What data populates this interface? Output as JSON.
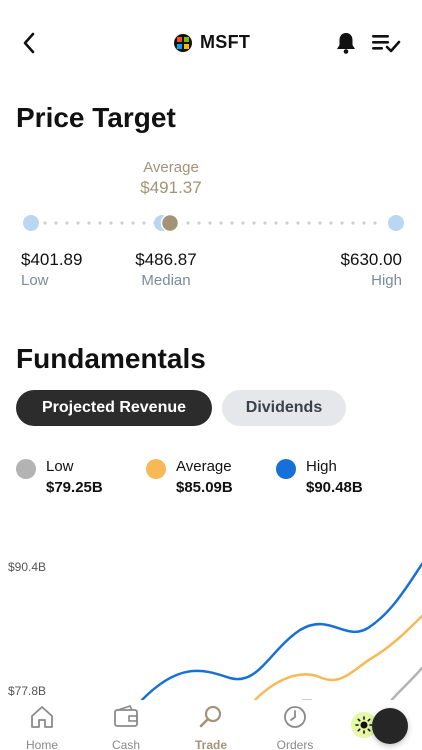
{
  "header": {
    "ticker": "MSFT",
    "icons": {
      "back": "chevron-left-icon",
      "logo": "microsoft-logo-icon",
      "bell": "bell-icon",
      "watchlist": "list-check-icon"
    }
  },
  "price_target": {
    "title": "Price Target",
    "average_label": "Average",
    "average_value": "$491.37",
    "low": {
      "value": "$401.89",
      "label": "Low"
    },
    "median": {
      "value": "$486.87",
      "label": "Median"
    },
    "high": {
      "value": "$630.00",
      "label": "High"
    }
  },
  "fundamentals": {
    "title": "Fundamentals",
    "tabs": [
      {
        "label": "Projected Revenue",
        "active": true
      },
      {
        "label": "Dividends",
        "active": false
      }
    ],
    "legend": [
      {
        "name": "Low",
        "value": "$79.25B",
        "color": "#b3b3b3"
      },
      {
        "name": "Average",
        "value": "$85.09B",
        "color": "#f7b955"
      },
      {
        "name": "High",
        "value": "$90.48B",
        "color": "#1670d8"
      }
    ],
    "y_labels": [
      "$90.4B",
      "$77.8B"
    ]
  },
  "colors": {
    "accent": "#a39378",
    "low": "#b3b3b3",
    "average": "#f7b955",
    "high": "#1670d8",
    "slider_dot": "#b9d6f2"
  },
  "tabbar": {
    "items": [
      {
        "label": "Home",
        "icon": "home-icon",
        "active": false
      },
      {
        "label": "Cash",
        "icon": "wallet-icon",
        "active": false
      },
      {
        "label": "Trade",
        "icon": "search-icon",
        "active": true
      },
      {
        "label": "Orders",
        "icon": "clock-icon",
        "active": false
      }
    ]
  }
}
